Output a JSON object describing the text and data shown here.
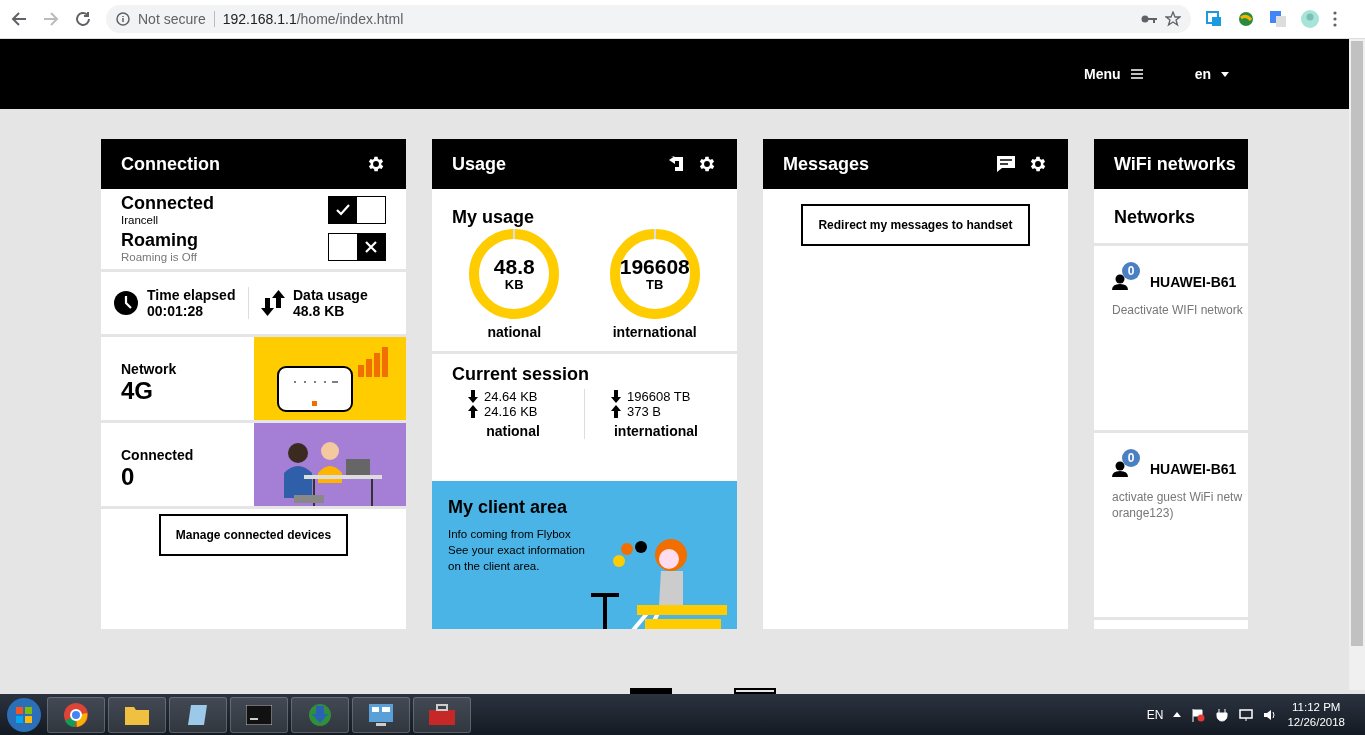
{
  "browser": {
    "security": "Not secure",
    "url_host": "192.168.1.1",
    "url_path": "/home/index.html"
  },
  "header": {
    "menu": "Menu",
    "language": "en"
  },
  "connection": {
    "title": "Connection",
    "toggles": [
      {
        "label": "Connected",
        "sub": "Irancell",
        "checked": true
      },
      {
        "label": "Roaming",
        "sub": "Roaming is Off",
        "checked": false
      }
    ],
    "stats": [
      {
        "label": "Time elapsed",
        "value": "00:01:28",
        "kind": "clock"
      },
      {
        "label": "Data usage",
        "value": "48.8 KB",
        "kind": "transfer"
      }
    ],
    "tiles": [
      {
        "label": "Network",
        "value": "4G",
        "kind": "router"
      },
      {
        "label": "Connected",
        "value": "0",
        "kind": "people"
      }
    ],
    "button": "Manage connected devices"
  },
  "usage": {
    "title": "Usage",
    "my_usage": "My usage",
    "gauges": [
      {
        "value": "48.8",
        "unit": "KB",
        "label": "national"
      },
      {
        "value": "196608",
        "unit": "TB",
        "label": "international"
      }
    ],
    "session_title": "Current session",
    "session": [
      {
        "down": "24.64 KB",
        "up": "24.16 KB",
        "label": "national"
      },
      {
        "down": "196608 TB",
        "up": "373 B",
        "label": "international"
      }
    ]
  },
  "client_area": {
    "title": "My client area",
    "lines": [
      "Info coming from Flybox",
      "See your exact information",
      "on the client area."
    ]
  },
  "messages": {
    "title": "Messages",
    "button": "Redirect my messages to handset"
  },
  "wifi": {
    "title": "WiFi networks",
    "subtitle": "Networks",
    "networks": [
      {
        "count": "0",
        "name": "HUAWEI-B61",
        "description": [
          "Deactivate WIFI network"
        ]
      },
      {
        "count": "0",
        "name": "HUAWEI-B61",
        "description": [
          "activate guest WiFi netw",
          "orange123)"
        ]
      }
    ]
  },
  "pager": [
    {
      "selected": true
    },
    {
      "selected": false
    }
  ],
  "taskbar": {
    "language": "EN",
    "time": "11:12 PM",
    "date": "12/26/2018"
  }
}
